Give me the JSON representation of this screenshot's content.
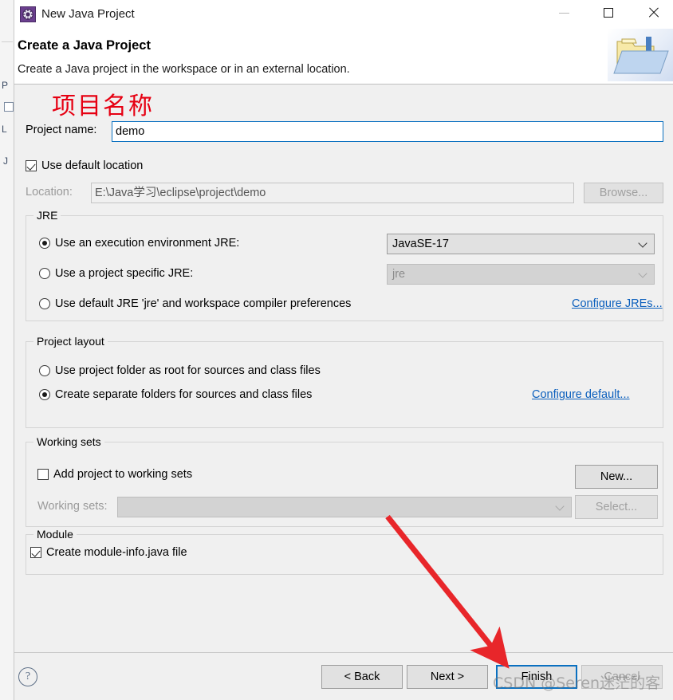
{
  "window": {
    "title": "New Java Project",
    "icon": "java-project-icon",
    "controls": {
      "minimize": "−",
      "maximize": "□",
      "close": "✕"
    }
  },
  "header": {
    "title": "Create a Java Project",
    "description": "Create a Java project in the workspace or in an external location.",
    "image": "new-java-project-banner-icon"
  },
  "annotation": {
    "chinese_label": "项目名称",
    "color": "#e60012",
    "arrow": "red-arrow-pointing-to-finish"
  },
  "form": {
    "project_name": {
      "label": "Project name:",
      "value": "demo",
      "placeholder": ""
    },
    "use_default_location": {
      "label": "Use default location",
      "checked": true
    },
    "location": {
      "label": "Location:",
      "value": "E:\\Java学习\\eclipse\\project\\demo",
      "enabled": false
    },
    "browse_button": {
      "label": "Browse...",
      "enabled": false
    }
  },
  "jre": {
    "group_title": "JRE",
    "options": [
      {
        "label": "Use an execution environment JRE:",
        "selected": true,
        "combo_value": "JavaSE-17",
        "combo_enabled": true
      },
      {
        "label": "Use a project specific JRE:",
        "selected": false,
        "combo_value": "jre",
        "combo_enabled": false
      },
      {
        "label": "Use default JRE 'jre' and workspace compiler preferences",
        "selected": false
      }
    ],
    "configure_link": "Configure JREs..."
  },
  "project_layout": {
    "group_title": "Project layout",
    "options": [
      {
        "label": "Use project folder as root for sources and class files",
        "selected": false
      },
      {
        "label": "Create separate folders for sources and class files",
        "selected": true
      }
    ],
    "configure_link": "Configure default..."
  },
  "working_sets": {
    "group_title": "Working sets",
    "add_checkbox": {
      "label": "Add project to working sets",
      "checked": false
    },
    "new_button": {
      "label": "New...",
      "enabled": true
    },
    "list_label": "Working sets:",
    "list_value": "",
    "select_button": {
      "label": "Select...",
      "enabled": false
    }
  },
  "module": {
    "group_title": "Module",
    "create_module_info": {
      "label": "Create module-info.java file",
      "checked": true
    }
  },
  "footer": {
    "help_icon": "?",
    "buttons": [
      {
        "name": "back",
        "label": "< Back",
        "enabled": true,
        "default": false
      },
      {
        "name": "next",
        "label": "Next >",
        "enabled": true,
        "default": false
      },
      {
        "name": "finish",
        "label": "Finish",
        "enabled": true,
        "default": true
      },
      {
        "name": "cancel",
        "label": "Cancel",
        "enabled": false,
        "default": false
      }
    ]
  },
  "watermark": {
    "text": "CSDN @Seren迷茫的客"
  },
  "colors": {
    "dialog_bg": "#f0f0f0",
    "focus_blue": "#0a70c0",
    "link_blue": "#0b5fbd",
    "annotation_red": "#e60012",
    "title_icon_purple": "#6b3f8f"
  }
}
